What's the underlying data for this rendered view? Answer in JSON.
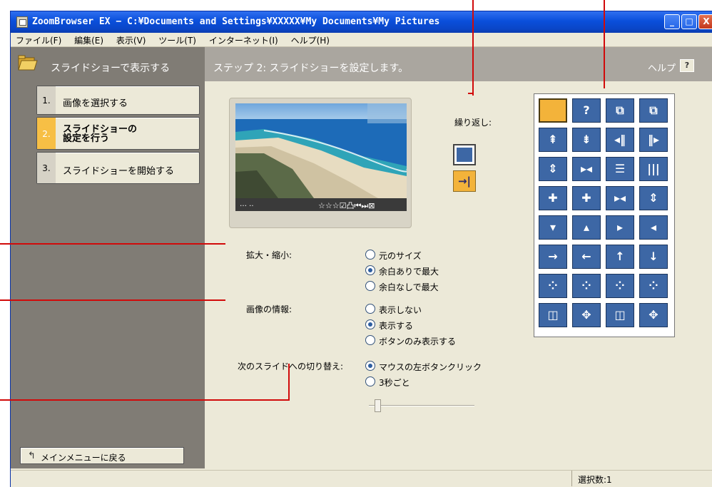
{
  "window": {
    "title": "ZoomBrowser EX  −  C:¥Documents and Settings¥XXXXX¥My Documents¥My Pictures",
    "min_glyph": "_",
    "max_glyph": "□",
    "close_glyph": "X"
  },
  "menu": [
    "ファイル(F)",
    "編集(E)",
    "表示(V)",
    "ツール(T)",
    "インターネット(I)",
    "ヘルプ(H)"
  ],
  "header": {
    "left_title": "スライドショーで表示する",
    "step_title": "ステップ 2: スライドショーを設定します。",
    "help_label": "ヘルプ",
    "help_glyph": "?"
  },
  "steps": [
    {
      "num": "1.",
      "label": "画像を選択する"
    },
    {
      "num": "2.",
      "label_line1": "スライドショーの",
      "label_line2": "設定を行う"
    },
    {
      "num": "3.",
      "label": "スライドショーを開始する"
    }
  ],
  "back": {
    "glyph": "↰",
    "label": "メインメニューに戻る"
  },
  "preview": {
    "bar_left": "…  ..",
    "bar_icons": "☆☆☆☑凸⏮⏭⊠"
  },
  "repeat": {
    "label": "繰り返し:",
    "once_glyph": "→|"
  },
  "zoom": {
    "label": "拡大・縮小:",
    "options": [
      "元のサイズ",
      "余白ありで最大",
      "余白なしで最大"
    ],
    "selected": 1
  },
  "info": {
    "label": "画像の情報:",
    "options": [
      "表示しない",
      "表示する",
      "ボタンのみ表示する"
    ],
    "selected": 1
  },
  "advance": {
    "label": "次のスライドへの切り替え:",
    "options": [
      "マウスの左ボタンクリック",
      "3秒ごと"
    ],
    "selected": 0,
    "slider_fraction": 0.06
  },
  "effects": [
    "",
    "?",
    "⧉",
    "⧉",
    "⇞",
    "⇟",
    "◂‖",
    "‖▸",
    "⇕",
    "▸◂",
    "☰",
    "|||",
    "✚",
    "✚",
    "▸◂",
    "⇕",
    "▾",
    "▴",
    "▸",
    "◂",
    "→",
    "←",
    "↑",
    "↓",
    "⁘",
    "⁘",
    "⁘",
    "⁘",
    "◫",
    "✥",
    "◫",
    "✥"
  ],
  "colors": {
    "titlebar": "#0a4fdb",
    "panel": "#807c75",
    "accent": "#f3b33a",
    "tile": "#3d67a5",
    "callout": "#d10a0a"
  },
  "status": {
    "selection": "選択数:1"
  }
}
